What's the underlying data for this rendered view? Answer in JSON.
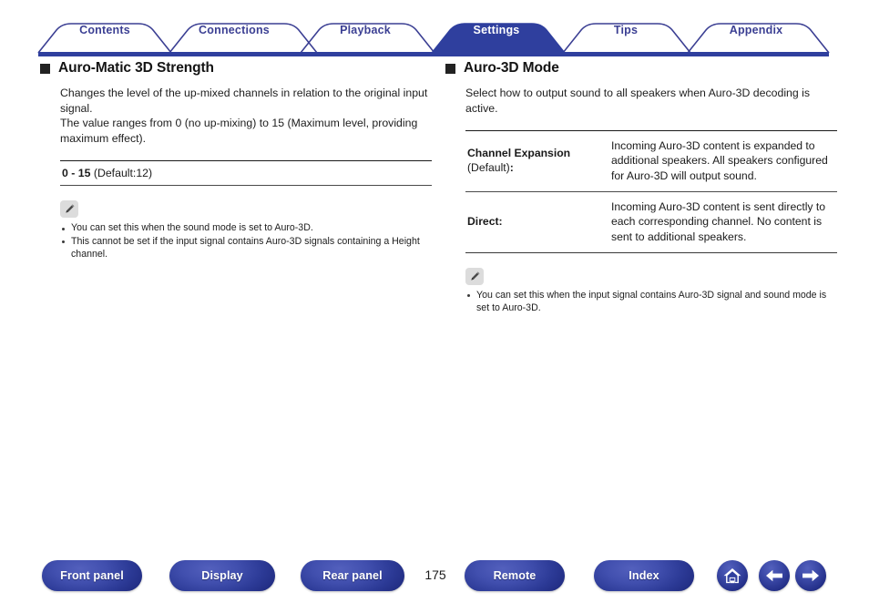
{
  "tabs": [
    {
      "label": "Contents",
      "active": false
    },
    {
      "label": "Connections",
      "active": false
    },
    {
      "label": "Playback",
      "active": false
    },
    {
      "label": "Settings",
      "active": true
    },
    {
      "label": "Tips",
      "active": false
    },
    {
      "label": "Appendix",
      "active": false
    }
  ],
  "left": {
    "title": "Auro-Matic 3D Strength",
    "body_line1": "Changes the level of the up-mixed channels in relation to the original input signal.",
    "body_line2": "The value ranges from 0 (no up-mixing) to 15 (Maximum level, providing maximum effect).",
    "value_bold": "0 - 15",
    "value_rest": " (Default:12)",
    "note_icon": "pencil-icon",
    "notes": [
      "You can set this when the sound mode is set to Auro-3D.",
      "This cannot be set if the input signal contains Auro-3D signals containing a Height channel."
    ]
  },
  "right": {
    "title": "Auro-3D Mode",
    "body_line1": "Select how to output sound to all speakers when Auro-3D decoding is active.",
    "rows": [
      {
        "key_name": "Channel Expansion",
        "key_sub": "(Default)",
        "key_sub_colon": ":",
        "value": "Incoming Auro-3D content is expanded to additional speakers. All speakers configured for Auro-3D will output sound."
      },
      {
        "key_name": "Direct:",
        "key_sub": "",
        "key_sub_colon": "",
        "value": "Incoming Auro-3D content is sent directly to each corresponding channel. No content is sent to additional speakers."
      }
    ],
    "note_icon": "pencil-icon",
    "notes": [
      "You can set this when the input signal contains Auro-3D signal and sound mode is set to Auro-3D."
    ]
  },
  "footer": {
    "buttons": [
      {
        "label": "Front panel",
        "name": "front-panel-button"
      },
      {
        "label": "Display",
        "name": "display-button"
      },
      {
        "label": "Rear panel",
        "name": "rear-panel-button"
      },
      {
        "label": "Remote",
        "name": "remote-button"
      },
      {
        "label": "Index",
        "name": "index-button"
      }
    ],
    "page_number": "175",
    "icons": [
      {
        "name": "home-icon"
      },
      {
        "name": "arrow-left-icon"
      },
      {
        "name": "arrow-right-icon"
      }
    ]
  },
  "colors": {
    "tab_outline": "#3b3f93",
    "tab_active_fill": "#2f3f9e",
    "tab_bar_rule": "#2f3f9e",
    "button_blue": "#2f3f9e",
    "text": "#1a1a1a"
  }
}
